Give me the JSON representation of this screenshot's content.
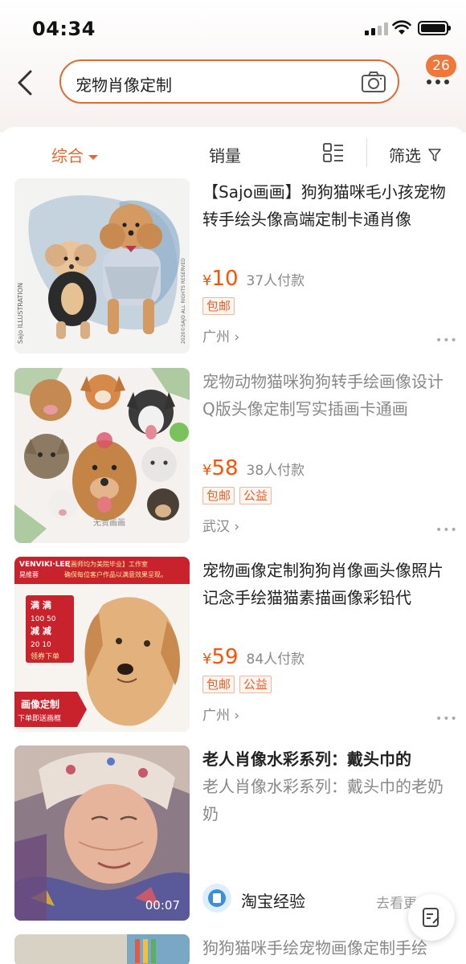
{
  "status_bar": {
    "time": "04:34"
  },
  "header": {
    "search_value": "宠物肖像定制",
    "message_badge": "26",
    "back_icon": "chevron-left-icon",
    "camera_icon": "camera-icon",
    "more_icon": "more-dots-icon"
  },
  "sort_bar": {
    "tabs": [
      "综合",
      "销量"
    ],
    "filter_label": "筛选"
  },
  "products": [
    {
      "title": "【Sajo画画】狗狗猫咪毛小孩宠物转手绘头像高端定制卡通肖像",
      "yen": "¥",
      "price": "10",
      "sold": "37人付款",
      "tags": [
        "包邮"
      ],
      "location": "广州 ›",
      "image_text": {
        "brand": "Sajo ILLUSTRATION",
        "copyright": "2020©SAJO ALL RIGHTS RESERVED"
      }
    },
    {
      "title": "宠物动物猫咪狗狗转手绘画像设计Q版头像定制写实插画卡通画",
      "yen": "¥",
      "price": "58",
      "sold": "38人付款",
      "tags": [
        "包邮",
        "公益"
      ],
      "location": "武汉 ›",
      "image_text": {
        "stamp": "无贵画画"
      }
    },
    {
      "title": "宠物画像定制狗狗肖像画头像照片记念手绘猫猫素描画像彩铅代",
      "yen": "¥",
      "price": "59",
      "sold": "84人付款",
      "tags": [
        "包邮",
        "公益"
      ],
      "location": "广州 ›",
      "image_text": {
        "brand": "VENVIKI·LEE",
        "brand_cn": "晃维蓉",
        "banner": "【画师均为美院毕业】工作室",
        "banner2": "确保每位客户作品以满意效果呈现。",
        "promo_lines": [
          "满  满",
          "100  50",
          "减  减",
          "20  10",
          "领券下单"
        ],
        "corner_title": "画像定制",
        "corner_sub": "下单即送画框"
      }
    }
  ],
  "experience": {
    "title": "老人肖像水彩系列：戴头巾的",
    "subtitle": "老人肖像水彩系列：戴头巾的老奶奶",
    "duration": "00:07",
    "source": "淘宝经验",
    "more": "去看更多 ›"
  },
  "partial_item": {
    "title": "狗狗猫咪手绘宠物画像定制手绘"
  },
  "colors": {
    "accent": "#e06a32",
    "price": "#ff5000",
    "badge": "#f0763a"
  }
}
